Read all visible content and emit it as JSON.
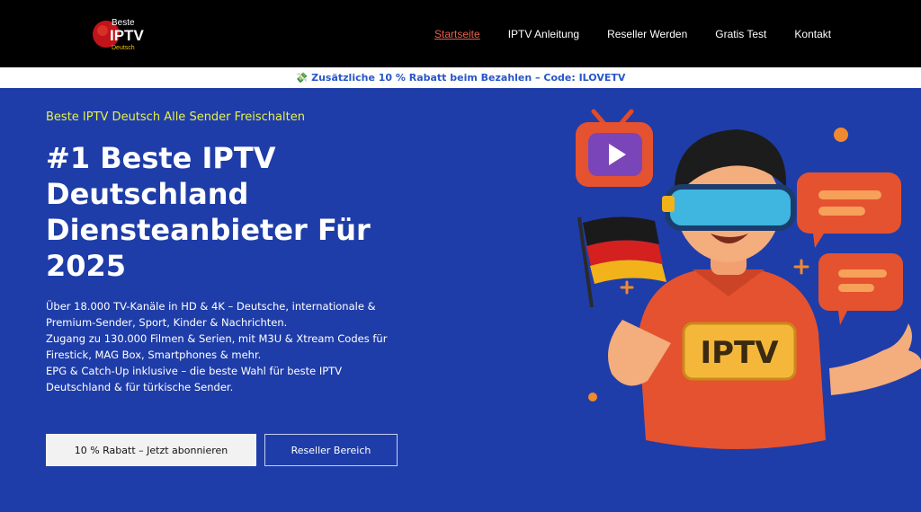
{
  "logo": {
    "line1": "Beste",
    "line2": "IPTV",
    "line3": "Deutsch"
  },
  "nav": {
    "items": [
      {
        "label": "Startseite",
        "active": true
      },
      {
        "label": "IPTV Anleitung",
        "active": false
      },
      {
        "label": "Reseller Werden",
        "active": false
      },
      {
        "label": "Gratis Test",
        "active": false
      },
      {
        "label": "Kontakt",
        "active": false
      }
    ]
  },
  "promo": {
    "icon": "money-icon",
    "text": "💸 Zusätzliche 10 % Rabatt beim Bezahlen – Code: ILOVETV"
  },
  "hero": {
    "eyebrow": "Beste IPTV Deutsch Alle Sender Freischalten",
    "headline": "#1 Beste IPTV Deutschland Diensteanbieter Für 2025",
    "paragraphs": [
      "Über 18.000 TV-Kanäle in HD & 4K – Deutsche, internationale & Premium-Sender, Sport, Kinder & Nachrichten.",
      "Zugang zu 130.000 Filmen & Serien, mit M3U & Xtream Codes für Firestick, MAG Box, Smartphones & mehr.",
      "EPG & Catch-Up inklusive – die beste Wahl für beste IPTV Deutschland & für türkische Sender."
    ],
    "primary_button": "10 % Rabatt – Jetzt abonnieren",
    "secondary_button": "Reseller Bereich",
    "illustration_label": "IPTV"
  },
  "colors": {
    "header_bg": "#000000",
    "hero_bg": "#1f3da8",
    "accent_active": "#e8604c",
    "eyebrow": "#e6f04a",
    "promo_text": "#2756c9"
  }
}
